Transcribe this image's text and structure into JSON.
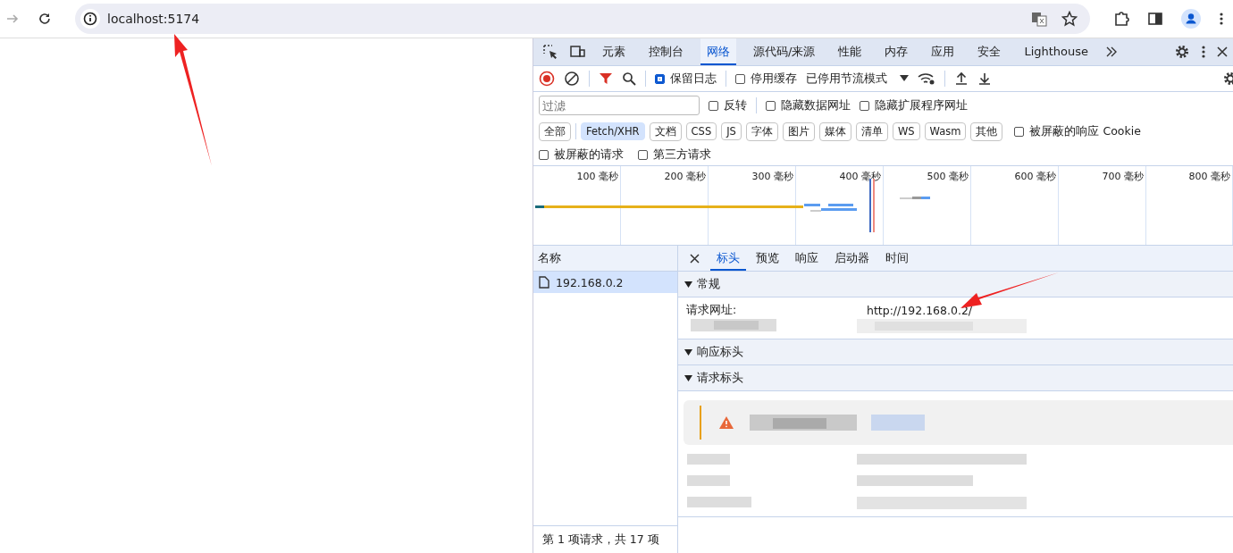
{
  "address_bar": {
    "url": "localhost:5174"
  },
  "devtools": {
    "tabs": [
      {
        "label": "元素",
        "selected": false
      },
      {
        "label": "控制台",
        "selected": false
      },
      {
        "label": "网络",
        "selected": true
      },
      {
        "label": "源代码/来源",
        "selected": false
      },
      {
        "label": "性能",
        "selected": false
      },
      {
        "label": "内存",
        "selected": false
      },
      {
        "label": "应用",
        "selected": false
      },
      {
        "label": "安全",
        "selected": false
      },
      {
        "label": "Lighthouse",
        "selected": false
      }
    ],
    "toolbar": {
      "recording": true,
      "preserve_log": {
        "label": "保留日志",
        "checked": true
      },
      "disable_cache": {
        "label": "停用缓存",
        "checked": false
      },
      "throttling": "已停用节流模式"
    },
    "filter": {
      "placeholder": "过滤",
      "options": [
        {
          "label": "反转",
          "checked": false
        },
        {
          "label": "隐藏数据网址",
          "checked": false
        },
        {
          "label": "隐藏扩展程序网址",
          "checked": false
        }
      ]
    },
    "type_filters": [
      {
        "label": "全部",
        "selected": false
      },
      {
        "label": "Fetch/XHR",
        "selected": true
      },
      {
        "label": "文档",
        "selected": false
      },
      {
        "label": "CSS",
        "selected": false
      },
      {
        "label": "JS",
        "selected": false
      },
      {
        "label": "字体",
        "selected": false
      },
      {
        "label": "图片",
        "selected": false
      },
      {
        "label": "媒体",
        "selected": false
      },
      {
        "label": "清单",
        "selected": false
      },
      {
        "label": "WS",
        "selected": false
      },
      {
        "label": "Wasm",
        "selected": false
      },
      {
        "label": "其他",
        "selected": false
      }
    ],
    "blocked_cookies": {
      "label": "被屏蔽的响应 Cookie",
      "checked": false
    },
    "more_options": [
      {
        "label": "被屏蔽的请求",
        "checked": false
      },
      {
        "label": "第三方请求",
        "checked": false
      }
    ],
    "timeline": {
      "ticks": [
        "100 毫秒",
        "200 毫秒",
        "300 毫秒",
        "400 毫秒",
        "500 毫秒",
        "600 毫秒",
        "700 毫秒",
        "800 毫秒"
      ]
    },
    "requests": {
      "column": "名称",
      "rows": [
        {
          "name": "192.168.0.2",
          "selected": true
        }
      ],
      "status": "第 1 项请求，共 17 项"
    },
    "details": {
      "tabs": [
        {
          "label": "标头",
          "selected": true
        },
        {
          "label": "预览",
          "selected": false
        },
        {
          "label": "响应",
          "selected": false
        },
        {
          "label": "启动器",
          "selected": false
        },
        {
          "label": "时间",
          "selected": false
        }
      ],
      "sections": [
        {
          "title": "常规",
          "kind": "fields",
          "expanded": true,
          "rows": [
            {
              "label": "请求网址:",
              "value": "http://192.168.0.2/"
            }
          ]
        },
        {
          "title": "响应标头",
          "kind": "empty",
          "expanded": true
        },
        {
          "title": "请求标头",
          "kind": "warning",
          "expanded": true
        }
      ]
    }
  }
}
